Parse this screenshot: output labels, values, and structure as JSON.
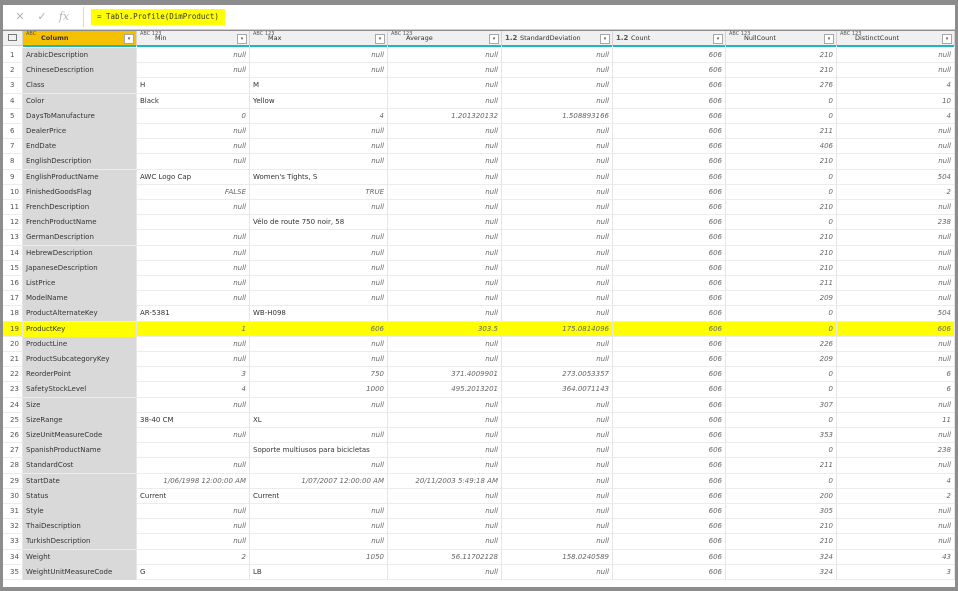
{
  "formula_bar": {
    "cancel_icon": "✕",
    "commit_icon": "✓",
    "fx_label": "fx",
    "formula": "= Table.Profile(DimProduct)"
  },
  "headers": [
    {
      "key": "column",
      "type": "ABC",
      "label": "Column"
    },
    {
      "key": "min",
      "type": "ABC 123",
      "label": "Min"
    },
    {
      "key": "max",
      "type": "ABC 123",
      "label": "Max"
    },
    {
      "key": "avg",
      "type": "ABC 123",
      "label": "Average"
    },
    {
      "key": "sd",
      "type": "1.2",
      "label": "StandardDeviation"
    },
    {
      "key": "cnt",
      "type": "1.2",
      "label": "Count"
    },
    {
      "key": "nc",
      "type": "ABC 123",
      "label": "NullCount"
    },
    {
      "key": "dc",
      "type": "ABC 123",
      "label": "DistinctCount"
    }
  ],
  "highlight_row": 19,
  "rows": [
    [
      "1",
      "ArabicDescription",
      "null",
      "null",
      "null",
      "null",
      "606",
      "210",
      "null"
    ],
    [
      "2",
      "ChineseDescription",
      "null",
      "null",
      "null",
      "null",
      "606",
      "210",
      "null"
    ],
    [
      "3",
      "Class",
      "H",
      "M",
      "null",
      "null",
      "606",
      "276",
      "4"
    ],
    [
      "4",
      "Color",
      "Black",
      "Yellow",
      "null",
      "null",
      "606",
      "0",
      "10"
    ],
    [
      "5",
      "DaysToManufacture",
      "0",
      "4",
      "1.201320132",
      "1.508893166",
      "606",
      "0",
      "4"
    ],
    [
      "6",
      "DealerPrice",
      "null",
      "null",
      "null",
      "null",
      "606",
      "211",
      "null"
    ],
    [
      "7",
      "EndDate",
      "null",
      "null",
      "null",
      "null",
      "606",
      "406",
      "null"
    ],
    [
      "8",
      "EnglishDescription",
      "null",
      "null",
      "null",
      "null",
      "606",
      "210",
      "null"
    ],
    [
      "9",
      "EnglishProductName",
      "AWC Logo Cap",
      "Women's Tights, S",
      "null",
      "null",
      "606",
      "0",
      "504"
    ],
    [
      "10",
      "FinishedGoodsFlag",
      "FALSE",
      "TRUE",
      "null",
      "null",
      "606",
      "0",
      "2"
    ],
    [
      "11",
      "FrenchDescription",
      "null",
      "null",
      "null",
      "null",
      "606",
      "210",
      "null"
    ],
    [
      "12",
      "FrenchProductName",
      "",
      "Vélo de route 750 noir, 58",
      "null",
      "null",
      "606",
      "0",
      "238"
    ],
    [
      "13",
      "GermanDescription",
      "null",
      "null",
      "null",
      "null",
      "606",
      "210",
      "null"
    ],
    [
      "14",
      "HebrewDescription",
      "null",
      "null",
      "null",
      "null",
      "606",
      "210",
      "null"
    ],
    [
      "15",
      "JapaneseDescription",
      "null",
      "null",
      "null",
      "null",
      "606",
      "210",
      "null"
    ],
    [
      "16",
      "ListPrice",
      "null",
      "null",
      "null",
      "null",
      "606",
      "211",
      "null"
    ],
    [
      "17",
      "ModelName",
      "null",
      "null",
      "null",
      "null",
      "606",
      "209",
      "null"
    ],
    [
      "18",
      "ProductAlternateKey",
      "AR-5381",
      "WB-H098",
      "null",
      "null",
      "606",
      "0",
      "504"
    ],
    [
      "19",
      "ProductKey",
      "1",
      "606",
      "303.5",
      "175.0814096",
      "606",
      "0",
      "606"
    ],
    [
      "20",
      "ProductLine",
      "null",
      "null",
      "null",
      "null",
      "606",
      "226",
      "null"
    ],
    [
      "21",
      "ProductSubcategoryKey",
      "null",
      "null",
      "null",
      "null",
      "606",
      "209",
      "null"
    ],
    [
      "22",
      "ReorderPoint",
      "3",
      "750",
      "371.4009901",
      "273.0053357",
      "606",
      "0",
      "6"
    ],
    [
      "23",
      "SafetyStockLevel",
      "4",
      "1000",
      "495.2013201",
      "364.0071143",
      "606",
      "0",
      "6"
    ],
    [
      "24",
      "Size",
      "null",
      "null",
      "null",
      "null",
      "606",
      "307",
      "null"
    ],
    [
      "25",
      "SizeRange",
      "38-40 CM",
      "XL",
      "null",
      "null",
      "606",
      "0",
      "11"
    ],
    [
      "26",
      "SizeUnitMeasureCode",
      "null",
      "null",
      "null",
      "null",
      "606",
      "353",
      "null"
    ],
    [
      "27",
      "SpanishProductName",
      "",
      "Soporte multiusos para bicicletas",
      "null",
      "null",
      "606",
      "0",
      "238"
    ],
    [
      "28",
      "StandardCost",
      "null",
      "null",
      "null",
      "null",
      "606",
      "211",
      "null"
    ],
    [
      "29",
      "StartDate",
      "1/06/1998 12:00:00 AM",
      "1/07/2007 12:00:00 AM",
      "20/11/2003 5:49:18 AM",
      "null",
      "606",
      "0",
      "4"
    ],
    [
      "30",
      "Status",
      "Current",
      "Current",
      "null",
      "null",
      "606",
      "200",
      "2"
    ],
    [
      "31",
      "Style",
      "null",
      "null",
      "null",
      "null",
      "606",
      "305",
      "null"
    ],
    [
      "32",
      "ThaiDescription",
      "null",
      "null",
      "null",
      "null",
      "606",
      "210",
      "null"
    ],
    [
      "33",
      "TurkishDescription",
      "null",
      "null",
      "null",
      "null",
      "606",
      "210",
      "null"
    ],
    [
      "34",
      "Weight",
      "2",
      "1050",
      "56.11702128",
      "158.0240589",
      "606",
      "324",
      "43"
    ],
    [
      "35",
      "WeightUnitMeasureCode",
      "G",
      "LB",
      "null",
      "null",
      "606",
      "324",
      "3"
    ]
  ]
}
